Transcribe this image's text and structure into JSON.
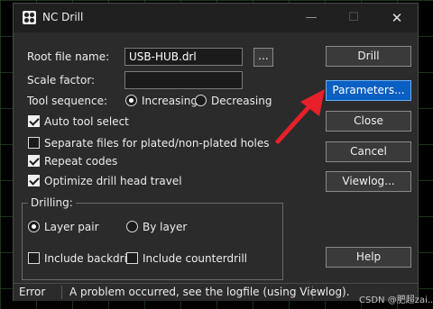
{
  "window": {
    "title": "NC Drill",
    "app_icon": "nc-drill-app-icon"
  },
  "title_controls": {
    "minimize": "—",
    "maximize": "☐",
    "close": "✕"
  },
  "form": {
    "root_file_label": "Root file name:",
    "root_file_value": "USB-HUB.drl",
    "browse_label": "...",
    "scale_label": "Scale factor:",
    "scale_value": "",
    "tool_seq_label": "Tool sequence:",
    "tool_seq_options": [
      {
        "label": "Increasing",
        "selected": true
      },
      {
        "label": "Decreasing",
        "selected": false
      }
    ],
    "checkboxes": [
      {
        "label": "Auto tool select",
        "checked": true
      },
      {
        "label": "Separate files for plated/non-plated holes",
        "checked": false
      },
      {
        "label": "Repeat codes",
        "checked": true
      },
      {
        "label": "Optimize drill head travel",
        "checked": true
      }
    ]
  },
  "drilling": {
    "group_label": "Drilling:",
    "options": [
      {
        "label": "Layer pair",
        "selected": true
      },
      {
        "label": "By layer",
        "selected": false
      }
    ],
    "checkboxes": [
      {
        "label": "Include backdrill",
        "checked": false
      },
      {
        "label": "Include counterdrill",
        "checked": false
      }
    ]
  },
  "buttons": {
    "drill": "Drill",
    "parameters": "Parameters...",
    "close": "Close",
    "cancel": "Cancel",
    "viewlog": "Viewlog...",
    "help": "Help"
  },
  "status": {
    "state": "Error",
    "message": "A problem occurred, see the logfile (using Viewlog)."
  },
  "watermark": "CSDN @肥超zai...",
  "annotation": {
    "color": "#e8202a",
    "points_to": "parameters-button"
  }
}
